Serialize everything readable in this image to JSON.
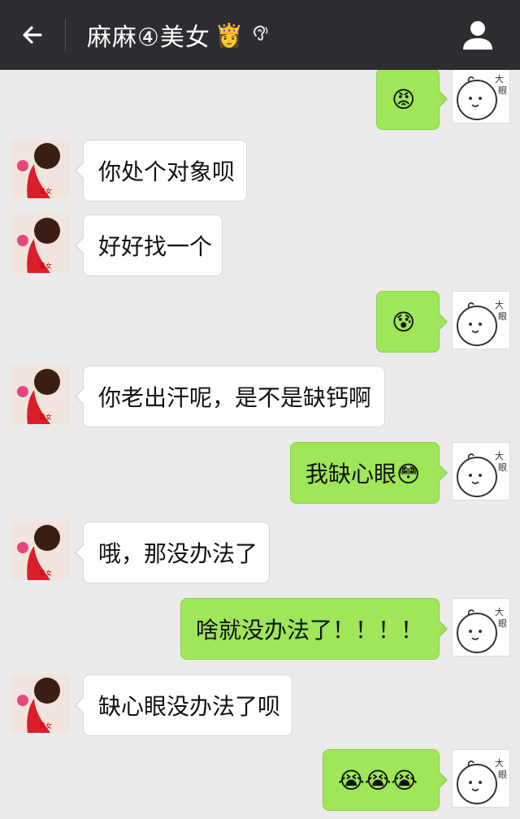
{
  "header": {
    "title": "麻麻④美女",
    "title_emoji": "👸",
    "ear_icon": "𝄞",
    "back_icon": "arrow-left-icon",
    "profile_icon": "person-icon"
  },
  "colors": {
    "header_bg": "#2c2d31",
    "chat_bg": "#ebebeb",
    "sent_bubble": "#9fe658",
    "received_bubble": "#ffffff"
  },
  "messages": [
    {
      "side": "right",
      "text": "😡"
    },
    {
      "side": "left",
      "text": "你处个对象呗"
    },
    {
      "side": "left",
      "text": "好好找一个"
    },
    {
      "side": "right",
      "text": "😰"
    },
    {
      "side": "left",
      "text": "你老出汗呢，是不是缺钙啊"
    },
    {
      "side": "right",
      "text": "我缺心眼😳"
    },
    {
      "side": "left",
      "text": "哦，那没办法了"
    },
    {
      "side": "right",
      "text": "啥就没办法了！！！！"
    },
    {
      "side": "left",
      "text": "缺心眼没办法了呗"
    },
    {
      "side": "right",
      "text": "😭😭😭"
    }
  ]
}
